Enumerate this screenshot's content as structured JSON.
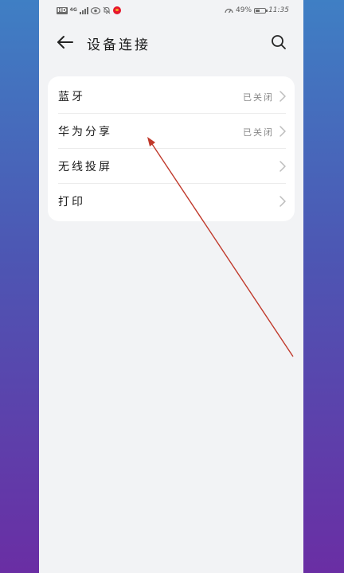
{
  "statusbar": {
    "hd": "HD",
    "network": "4G",
    "battery_percent": "49%",
    "battery_level": 0.49,
    "time": "11:35"
  },
  "header": {
    "title": "设备连接"
  },
  "settings": [
    {
      "label": "蓝牙",
      "value": "已关闭"
    },
    {
      "label": "华为分享",
      "value": "已关闭"
    },
    {
      "label": "无线投屏",
      "value": ""
    },
    {
      "label": "打印",
      "value": ""
    }
  ],
  "icons": [
    "arrow-left-icon",
    "search-icon",
    "chevron-right-icon",
    "eye-icon",
    "bell-off-icon",
    "weibo-icon",
    "speed-icon",
    "battery-icon",
    "signal-icon"
  ],
  "colors": {
    "annotation_arrow": "#c0392b",
    "page_background": "#f2f3f5",
    "card_background": "#ffffff"
  }
}
